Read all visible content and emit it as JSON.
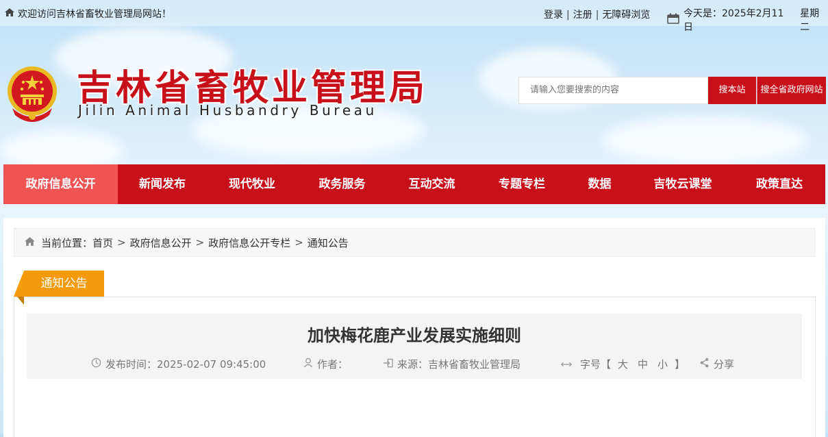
{
  "topbar": {
    "welcome": "欢迎访问吉林省畜牧业管理局网站！",
    "login": "登录",
    "register": "注册",
    "accessible": "无障碍浏览",
    "separator": "|",
    "date_label": "今天是：2025年2月11日",
    "weekday": "星期二"
  },
  "header": {
    "title_cn": "吉林省畜牧业管理局",
    "title_en": "Jilin Animal Husbandry Bureau",
    "search_placeholder": "请输入您要搜索的内容",
    "search_site": "搜本站",
    "search_all": "搜全省政府网站"
  },
  "nav": {
    "items": [
      {
        "label": "政府信息公开"
      },
      {
        "label": "新闻发布"
      },
      {
        "label": "现代牧业"
      },
      {
        "label": "政务服务"
      },
      {
        "label": "互动交流"
      },
      {
        "label": "专题专栏"
      },
      {
        "label": "数据"
      },
      {
        "label": "吉牧云课堂"
      },
      {
        "label": "政策直达"
      }
    ],
    "active_index": 0
  },
  "breadcrumb": {
    "prefix": "当前位置：",
    "items": [
      "首页",
      "政府信息公开",
      "政府信息公开专栏",
      "通知公告"
    ],
    "arrow": ">"
  },
  "section_tag": "通知公告",
  "article": {
    "title": "加快梅花鹿产业发展实施细则",
    "publish_label": "发布时间：2025-02-07 09:45:00",
    "author_label": "作者：",
    "source_label": "来源：吉林省畜牧业管理局",
    "fontsize_label": "字号【",
    "fontsize_close": "】",
    "fontsize_large": "大",
    "fontsize_medium": "中",
    "fontsize_small": "小",
    "share_label": "分享"
  },
  "colors": {
    "brand_red": "#c8101a",
    "nav_active": "#ef5353",
    "tag_orange": "#f59a0b"
  }
}
